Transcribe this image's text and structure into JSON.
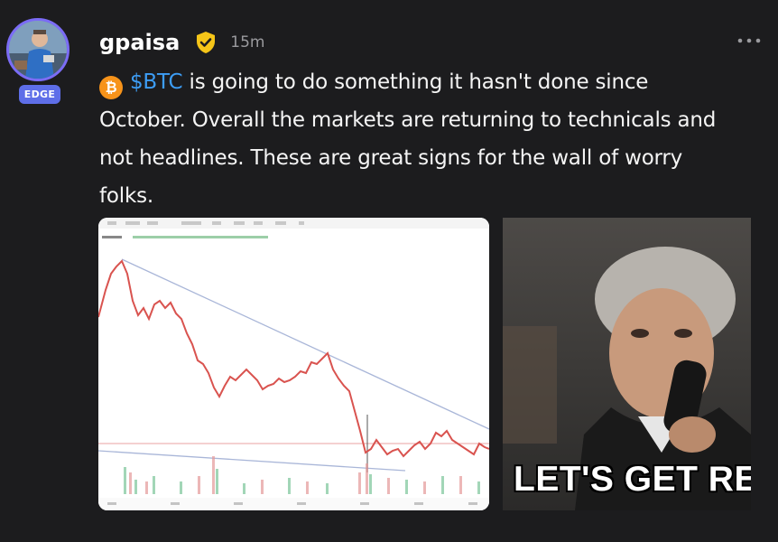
{
  "post": {
    "username": "gpaisa",
    "badge": "EDGE",
    "timestamp": "15m",
    "text_lines": [
      "is going to do something it hasn't done since",
      "October. Overall the markets are returning to technicals and",
      "not headlines. These are great signs for the wall of worry",
      "folks."
    ],
    "cashtag": "$BTC",
    "btc_symbol": "₿"
  },
  "media": {
    "gif_caption": "LET'S GET RE"
  },
  "icons": {
    "verified": "verified-badge-icon",
    "more": "more-options-icon",
    "coin": "bitcoin-icon"
  },
  "colors": {
    "background": "#1c1c1e",
    "cashtag": "#3d9df5",
    "badge": "#5e6ee8",
    "verified": "#f5c518",
    "bitcoin": "#f7931a"
  }
}
